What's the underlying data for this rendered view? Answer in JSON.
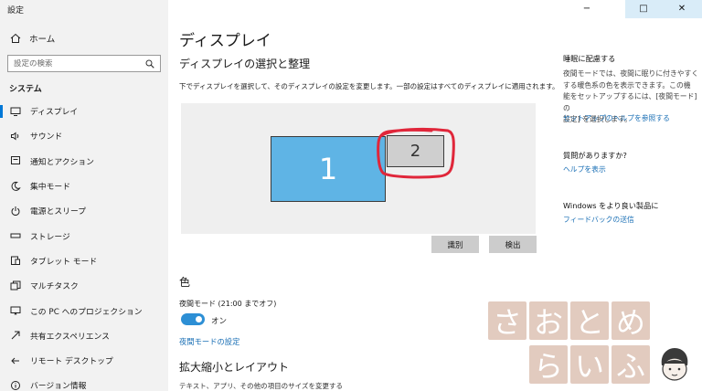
{
  "window": {
    "app_title": "設定",
    "controls": [
      "−",
      "□",
      "✕"
    ]
  },
  "sidebar": {
    "home_label": "ホーム",
    "search_placeholder": "設定の検索",
    "section_label": "システム",
    "items": [
      {
        "label": "ディスプレイ",
        "icon": "monitor-icon"
      },
      {
        "label": "サウンド",
        "icon": "speaker-icon"
      },
      {
        "label": "通知とアクション",
        "icon": "notification-icon"
      },
      {
        "label": "集中モード",
        "icon": "moon-icon"
      },
      {
        "label": "電源とスリープ",
        "icon": "power-icon"
      },
      {
        "label": "ストレージ",
        "icon": "storage-icon"
      },
      {
        "label": "タブレット モード",
        "icon": "tablet-icon"
      },
      {
        "label": "マルチタスク",
        "icon": "multitask-icon"
      },
      {
        "label": "この PC へのプロジェクション",
        "icon": "projection-icon"
      },
      {
        "label": "共有エクスペリエンス",
        "icon": "share-icon"
      },
      {
        "label": "リモート デスクトップ",
        "icon": "remote-icon"
      },
      {
        "label": "バージョン情報",
        "icon": "info-icon"
      }
    ]
  },
  "main": {
    "title": "ディスプレイ",
    "arrange_heading": "ディスプレイの選択と整理",
    "arrange_desc": "下でディスプレイを選択して、そのディスプレイの設定を変更します。一部の設定はすべてのディスプレイに適用されます。",
    "monitor_1": "1",
    "monitor_2": "2",
    "identify_button": "識別",
    "detect_button": "検出",
    "color_heading": "色",
    "night_mode_label": "夜間モード (21:00 までオフ)",
    "night_mode_state": "オン",
    "night_mode_link": "夜間モードの設定",
    "scale_heading": "拡大縮小とレイアウト",
    "scale_desc": "テキスト、アプリ、その他の項目のサイズを変更する"
  },
  "rail": {
    "sleep_title": "睡眠に配慮する",
    "sleep_body": [
      "夜間モードでは、夜間に眠りに付きやすく",
      "する暖色系の色を表示できます。この機",
      "能をセットアップするには、[夜間モード] の",
      "設定] を選択します。"
    ],
    "sleep_link": "セットアップのヘルプを参照する",
    "question_title": "質問がありますか?",
    "question_link": "ヘルプを表示",
    "improve_title": "Windows をより良い製品に",
    "improve_link": "フィードバックの送信"
  },
  "watermark": {
    "row1": [
      "さ",
      "お",
      "と",
      "め"
    ],
    "row2": [
      "ら",
      "い",
      "ふ"
    ]
  },
  "colors": {
    "accent": "#0078d7",
    "monitor_selected": "#5fb4e5",
    "annotation": "#e0263a",
    "watermark": "#ddc2b5"
  }
}
